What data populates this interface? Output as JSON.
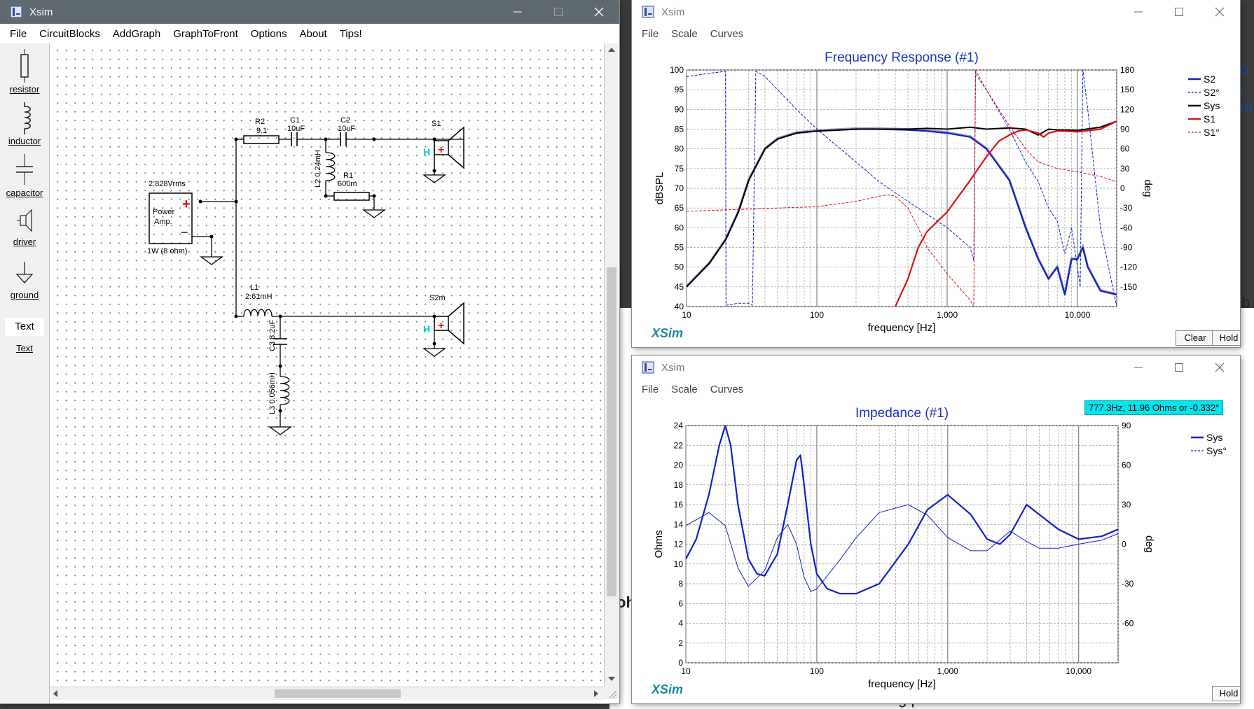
{
  "background": {
    "text_right_1": "o",
    "text_right_2": "/",
    "text_right_3": "m",
    "text_right_4": "b",
    "text_mid": "oh",
    "text_bottom": "er than as a starting point."
  },
  "schematic_window": {
    "title": "Xsim",
    "menu": [
      "File",
      "CircuitBlocks",
      "AddGraph",
      "GraphToFront",
      "Options",
      "About",
      "Tips!"
    ],
    "palette": [
      {
        "label": "resistor",
        "icon": "resistor-icon"
      },
      {
        "label": "inductor",
        "icon": "inductor-icon"
      },
      {
        "label": "capacitor",
        "icon": "capacitor-icon"
      },
      {
        "label": "driver",
        "icon": "driver-icon"
      },
      {
        "label": "ground",
        "icon": "ground-icon"
      },
      {
        "label": "Text",
        "icon": "text-tool-icon"
      },
      {
        "label": "Text",
        "icon": "text-link-icon"
      }
    ],
    "circuit": {
      "amp_voltage": "2.828Vrms",
      "amp_name_1": "Power",
      "amp_name_2": "Amp.",
      "amp_power": "1W (8 ohm)",
      "r2_name": "R2",
      "r2_value": "9.1",
      "c1_name": "C1",
      "c1_value": "10uF",
      "c2_name": "C2",
      "c2_value": "10uF",
      "l2_label": "L2 0.24mH",
      "r1_name": "R1",
      "r1_value": "600m",
      "s1_name": "S1",
      "l1_name": "L1",
      "l1_value": "2.61mH",
      "s2_name": "S2m",
      "c3_label": "C3 8.2uF",
      "l3_label": "L3 0.056mH"
    }
  },
  "fr_window": {
    "title": "Xsim",
    "menu": [
      "File",
      "Scale",
      "Curves"
    ],
    "buttons": {
      "clear": "Clear",
      "hold": "Hold"
    },
    "brand": "XSim"
  },
  "imp_window": {
    "title": "Xsim",
    "menu": [
      "File",
      "Scale",
      "Curves"
    ],
    "buttons": {
      "hold": "Hold"
    },
    "brand": "XSim",
    "cursor_readout": "777.3Hz, 11.96 Ohms or -0.332°"
  },
  "colors": {
    "title_blue": "#1a32c8",
    "curve_blue": "#1020c8",
    "curve_red": "#e01010",
    "curve_black": "#000000",
    "curve_gray": "#8a8aa0",
    "brand_teal": "#1a8aa0",
    "readout_bg": "#00e5ee",
    "dark_titlebar": "#5f6a70"
  },
  "chart_data": [
    {
      "type": "line",
      "title": "Frequency Response (#1)",
      "xlabel": "frequency [Hz]",
      "ylabel": "dBSPL",
      "y2label": "deg",
      "x_scale": "log",
      "xlim": [
        10,
        20000
      ],
      "ylim": [
        40,
        100
      ],
      "y2lim": [
        -180,
        180
      ],
      "x_ticks": [
        "10",
        "100",
        "1,000",
        "10,000"
      ],
      "x_tick_values": [
        10,
        100,
        1000,
        10000
      ],
      "y_ticks": [
        40,
        45,
        50,
        55,
        60,
        65,
        70,
        75,
        80,
        85,
        90,
        95,
        100
      ],
      "y2_ticks": [
        -150,
        -120,
        -90,
        -60,
        -30,
        0,
        30,
        60,
        90,
        120,
        150,
        180
      ],
      "grid": true,
      "legend_position": "right",
      "legend": [
        {
          "name": "S2",
          "color": "#1020c8",
          "dash": false
        },
        {
          "name": "S2°",
          "color": "#1020c8",
          "dash": true
        },
        {
          "name": "Sys",
          "color": "#000000",
          "dash": false
        },
        {
          "name": "S1",
          "color": "#e01010",
          "dash": false
        },
        {
          "name": "S1°",
          "color": "#e01010",
          "dash": true
        }
      ],
      "series": [
        {
          "name": "S2",
          "axis": "y",
          "color": "#1020c8",
          "width": 2.2,
          "dash": false,
          "x": [
            10,
            15,
            20,
            25,
            30,
            40,
            50,
            70,
            100,
            200,
            300,
            500,
            700,
            1000,
            1500,
            2000,
            3000,
            4000,
            5000,
            6000,
            7000,
            8000,
            9000,
            10000,
            11000,
            12000,
            15000,
            20000
          ],
          "y": [
            45,
            51,
            57,
            64,
            72,
            80,
            82.5,
            84,
            84.5,
            85,
            85,
            84.8,
            84.5,
            84,
            83,
            80,
            72,
            60,
            52,
            47,
            50,
            43,
            52,
            52,
            55,
            50,
            44,
            43
          ]
        },
        {
          "name": "Sys",
          "axis": "y",
          "color": "#000000",
          "width": 2.0,
          "dash": false,
          "x": [
            10,
            15,
            20,
            25,
            30,
            40,
            50,
            70,
            100,
            200,
            300,
            500,
            700,
            1000,
            1500,
            2000,
            3000,
            4000,
            5000,
            6000,
            7000,
            10000,
            15000,
            20000
          ],
          "y": [
            45,
            51,
            57,
            64,
            72,
            80,
            82.5,
            84,
            84.5,
            85,
            85,
            85,
            85.2,
            85,
            85.5,
            85,
            85.3,
            85,
            83.5,
            85,
            84.8,
            84.7,
            85.5,
            87
          ]
        },
        {
          "name": "S1",
          "axis": "y",
          "color": "#e01010",
          "width": 2.2,
          "dash": false,
          "x": [
            400,
            500,
            600,
            700,
            1000,
            1500,
            2000,
            2500,
            3000,
            3500,
            4000,
            5000,
            5500,
            6000,
            7000,
            8000,
            10000,
            15000,
            20000
          ],
          "y": [
            40,
            47,
            55,
            59,
            64,
            72,
            78,
            82,
            83.5,
            84.5,
            84.8,
            84,
            83,
            84,
            84.5,
            84.5,
            84.3,
            85,
            87
          ]
        },
        {
          "name": "S2°",
          "axis": "y2",
          "color": "#1020c8",
          "width": 1,
          "dash": true,
          "x": [
            10,
            15,
            19.9,
            20.1,
            25,
            30,
            32,
            34,
            40,
            50,
            70,
            100,
            200,
            300,
            500,
            1000,
            1500,
            1600,
            1650,
            1700,
            2000,
            3000,
            4000,
            5000,
            6000,
            7000,
            8000,
            9000,
            10000,
            10500,
            11000,
            12000,
            15000,
            20000
          ],
          "y": [
            170,
            175,
            178,
            -178,
            -175,
            -175,
            -178,
            178,
            170,
            150,
            120,
            90,
            40,
            10,
            -20,
            -60,
            -90,
            -110,
            180,
            170,
            150,
            90,
            40,
            10,
            -30,
            -50,
            -100,
            -60,
            -120,
            -150,
            180,
            120,
            -60,
            -180
          ]
        },
        {
          "name": "S1°",
          "axis": "y2",
          "color": "#e01010",
          "width": 1,
          "dash": true,
          "x": [
            10,
            100,
            200,
            300,
            350,
            400,
            500,
            600,
            700,
            1000,
            1500,
            1600,
            1650,
            1700,
            2000,
            3000,
            4000,
            5000,
            7000,
            10000,
            15000,
            20000
          ],
          "y": [
            -35,
            -28,
            -20,
            -12,
            -10,
            -12,
            -30,
            -60,
            -90,
            -130,
            -170,
            -180,
            178,
            175,
            150,
            95,
            60,
            40,
            30,
            25,
            18,
            10
          ]
        }
      ]
    },
    {
      "type": "line",
      "title": "Impedance (#1)",
      "xlabel": "frequency [Hz]",
      "ylabel": "Ohms",
      "y2label": "deg",
      "x_scale": "log",
      "xlim": [
        10,
        20000
      ],
      "ylim": [
        0,
        24
      ],
      "y2lim": [
        -90,
        90
      ],
      "x_ticks": [
        "10",
        "100",
        "1,000",
        "10,000"
      ],
      "x_tick_values": [
        10,
        100,
        1000,
        10000
      ],
      "y_ticks": [
        0,
        2,
        4,
        6,
        8,
        10,
        12,
        14,
        16,
        18,
        20,
        22,
        24
      ],
      "y2_ticks": [
        -60,
        -30,
        0,
        30,
        60,
        90
      ],
      "grid": true,
      "legend_position": "top-right",
      "legend": [
        {
          "name": "Sys",
          "color": "#1020c8",
          "dash": false
        },
        {
          "name": "Sys°",
          "color": "#1020c8",
          "dash": true
        }
      ],
      "series": [
        {
          "name": "Sys",
          "axis": "y",
          "color": "#1020c8",
          "width": 2.2,
          "dash": false,
          "x": [
            10,
            12,
            15,
            18,
            20,
            22,
            25,
            30,
            35,
            40,
            50,
            60,
            70,
            75,
            80,
            90,
            100,
            120,
            150,
            200,
            300,
            500,
            700,
            1000,
            1500,
            2000,
            2500,
            3000,
            4000,
            5000,
            7000,
            10000,
            15000,
            20000
          ],
          "y": [
            10.5,
            12.5,
            17,
            22,
            24,
            22,
            16,
            10.5,
            9,
            8.8,
            11,
            16,
            20.5,
            21,
            18,
            12,
            9,
            7.5,
            7,
            7,
            8,
            12,
            15.5,
            17,
            15,
            12.5,
            12,
            13,
            16,
            15,
            13.5,
            12.5,
            12.8,
            13.5
          ]
        },
        {
          "name": "Sys°",
          "axis": "y2",
          "color": "#1020c8",
          "width": 1,
          "dash": false,
          "x": [
            10,
            15,
            20,
            25,
            30,
            40,
            50,
            60,
            70,
            80,
            90,
            100,
            150,
            200,
            300,
            500,
            700,
            1000,
            1500,
            2000,
            3000,
            4000,
            5000,
            7000,
            10000,
            15000,
            20000
          ],
          "y": [
            14,
            24,
            14,
            -18,
            -32,
            -20,
            5,
            15,
            0,
            -25,
            -36,
            -34,
            -12,
            5,
            24,
            30,
            22,
            5,
            -5,
            -5,
            10,
            2,
            -3,
            -3,
            0,
            3,
            8
          ]
        }
      ]
    }
  ]
}
